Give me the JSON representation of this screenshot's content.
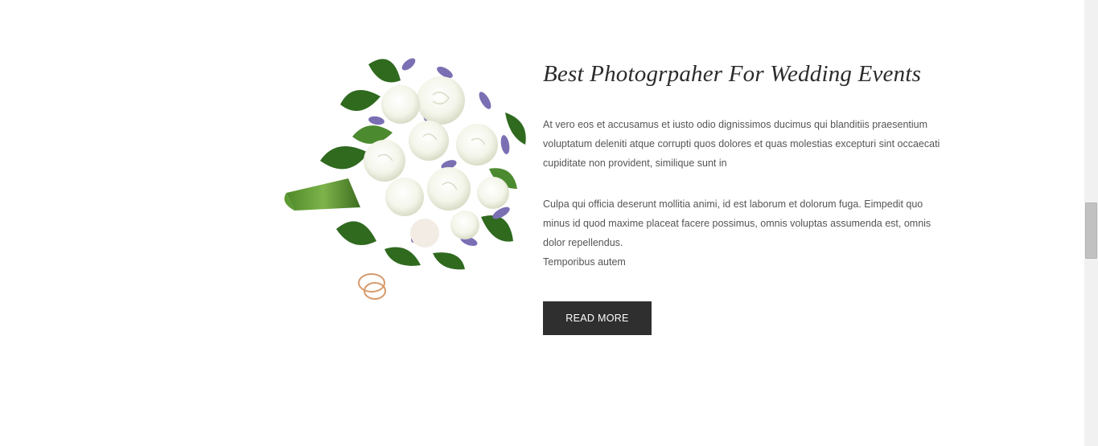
{
  "feature": {
    "title": "Best Photogrpaher For Wedding Events",
    "paragraph1": "At vero eos et accusamus et iusto odio dignissimos ducimus qui blanditiis praesentium voluptatum deleniti atque corrupti quos dolores et quas molestias excepturi sint occaecati cupiditate non provident, similique sunt in",
    "paragraph2_line1": "Culpa qui officia deserunt mollitia animi, id est laborum et dolorum fuga. Eimpedit quo minus id quod maxime placeat facere possimus, omnis voluptas assumenda est, omnis dolor repellendus.",
    "paragraph2_line2": "Temporibus autem",
    "button_label": "READ MORE"
  },
  "colors": {
    "button_bg": "#2f2f2f",
    "button_text": "#ffffff",
    "title": "#2b2b2b",
    "body_text": "#555555"
  }
}
